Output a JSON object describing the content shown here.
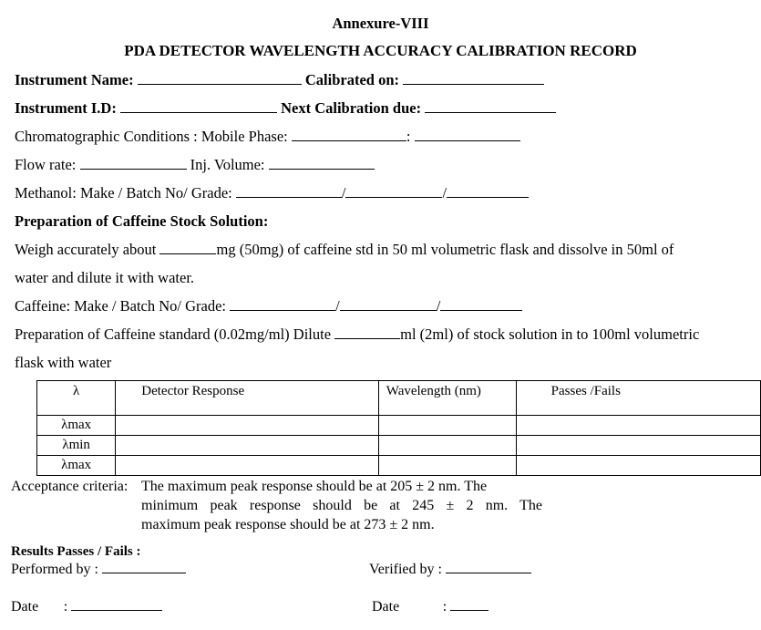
{
  "header": {
    "annexure": "Annexure-VIII",
    "title": "PDA DETECTOR WAVELENGTH ACCURACY CALIBRATION RECORD"
  },
  "fields": {
    "instrument_name_label": "Instrument Name:",
    "calibrated_on_label": "Calibrated on:",
    "instrument_id_label": "Instrument I.D:",
    "next_calibration_label": "Next Calibration due:",
    "chromatographic_label": "Chromatographic Conditions : Mobile Phase:",
    "colon_sep": ":",
    "flow_rate_label": "Flow rate:",
    "inj_volume_label": "Inj. Volume:",
    "methanol_label": "Methanol: Make / Batch No/ Grade:",
    "slash": "/"
  },
  "stock": {
    "heading": "Preparation of Caffeine Stock Solution:",
    "weigh_prefix": "Weigh accurately about",
    "weigh_suffix": "mg (50mg) of caffeine std in 50 ml volumetric flask and dissolve in 50ml of",
    "weigh_line2": "water and dilute it with water.",
    "caffeine_label": "Caffeine: Make / Batch No/ Grade:",
    "standard_prefix": "Preparation of Caffeine standard (0.02mg/ml) Dilute",
    "standard_suffix": "ml (2ml) of stock solution in to 100ml volumetric",
    "standard_line2": "flask with water"
  },
  "table": {
    "headers": [
      "λ",
      "Detector Response",
      "Wavelength (nm)",
      "Passes /Fails"
    ],
    "rows": [
      [
        "λmax",
        "",
        "",
        ""
      ],
      [
        "λmin",
        "",
        "",
        ""
      ],
      [
        "λmax",
        "",
        "",
        ""
      ]
    ]
  },
  "acceptance": {
    "label": "Acceptance criteria:",
    "line1": "The maximum peak response should be at 205 ± 2 nm. The",
    "line2": "minimum peak response should be at 245 ± 2 nm. The",
    "line3": "maximum peak response should be at 273 ± 2 nm."
  },
  "signoff": {
    "results_label": "Results   Passes / Fails :",
    "performed_by_label": "Performed by :",
    "verified_by_label": "Verified by :",
    "date_label": "Date",
    "date_colon": ":",
    "date2_label": "Date"
  }
}
